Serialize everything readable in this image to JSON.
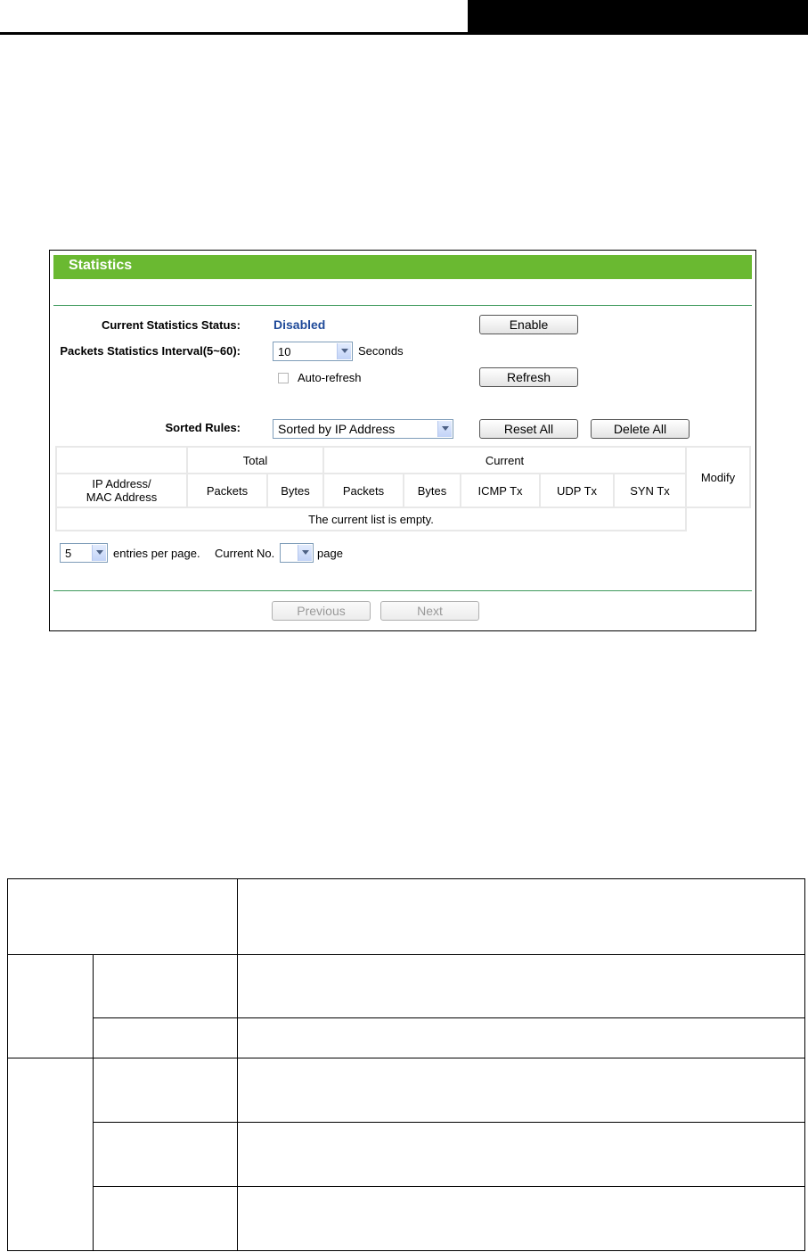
{
  "panel": {
    "title": "Statistics",
    "status_label": "Current Statistics Status:",
    "status_value": "Disabled",
    "enable_button": "Enable",
    "interval_label": "Packets Statistics Interval(5~60):",
    "interval_value": "10",
    "interval_unit": "Seconds",
    "autorefresh_label": "Auto-refresh",
    "refresh_button": "Refresh",
    "sorted_label": "Sorted Rules:",
    "sorted_value": "Sorted by IP Address",
    "reset_button": "Reset All",
    "delete_button": "Delete All",
    "table": {
      "group_total": "Total",
      "group_current": "Current",
      "modify": "Modify",
      "col_address_line1": "IP Address/",
      "col_address_line2": "MAC Address",
      "col_total_packets": "Packets",
      "col_total_bytes": "Bytes",
      "col_current_packets": "Packets",
      "col_current_bytes": "Bytes",
      "col_icmp": "ICMP Tx",
      "col_udp": "UDP Tx",
      "col_syn": "SYN Tx",
      "empty_message": "The current list is empty."
    },
    "entries_value": "5",
    "entries_text": "entries per page.",
    "current_no_label": "Current No.",
    "page_text": "page",
    "previous_button": "Previous",
    "next_button": "Next"
  },
  "colors": {
    "title_bar": "#6ab931",
    "status_value": "#1f4a99",
    "divider": "#3f9a5d"
  }
}
